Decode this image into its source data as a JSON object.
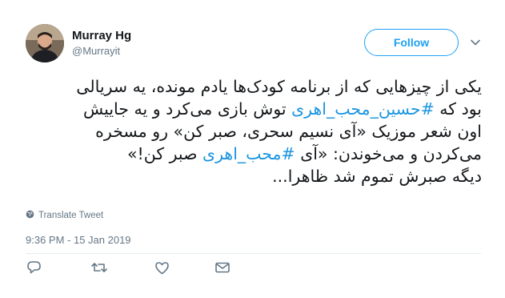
{
  "tweet": {
    "author": {
      "display_name": "Murray Hg",
      "handle": "@Murrayit"
    },
    "follow_label": "Follow",
    "text_lines": [
      [
        {
          "t": "یکی از چیزهایی که از برنامه کودک‌ها یادم مونده، یه سریالی"
        }
      ],
      [
        {
          "t": "بود که "
        },
        {
          "t": "#حسین_محب_اهری",
          "hashtag": true
        },
        {
          "t": " توش بازی می‌کرد و یه جاییش"
        }
      ],
      [
        {
          "t": "اون شعر موزیک «آی نسیم سحری، صبر کن» رو مسخره"
        }
      ],
      [
        {
          "t": "می‌کردن و می‌خوندن: «آی "
        },
        {
          "t": "#محب_اهری",
          "hashtag": true
        },
        {
          "t": " صبر کن!»"
        }
      ],
      [
        {
          "t": "دیگه صبرش تموم شد ظاهرا..."
        }
      ]
    ],
    "translate_label": "Translate Tweet",
    "timestamp": "9:36 PM - 15 Jan 2019"
  },
  "colors": {
    "accent": "#1da1f2",
    "hashtag": "#1b95e0",
    "muted": "#657786",
    "text": "#14171a",
    "divider": "#e6ecf0"
  },
  "icons": {
    "caret": "chevron-down-icon",
    "translate": "globe-icon",
    "reply": "reply-icon",
    "retweet": "retweet-icon",
    "like": "heart-icon",
    "message": "envelope-icon"
  }
}
